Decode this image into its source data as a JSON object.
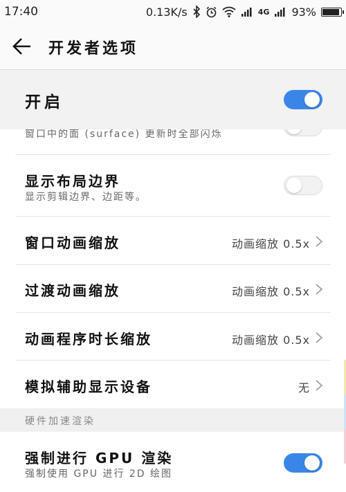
{
  "status_bar": {
    "time": "17:40",
    "speed": "0.13K/s",
    "network": "4G",
    "battery_percent": "93%",
    "battery_level": 0.93,
    "icons": [
      "bluetooth-icon",
      "alarm-icon",
      "wifi-icon",
      "signal-icon",
      "signal-icon",
      "battery-icon"
    ]
  },
  "header": {
    "title": "开发者选项",
    "back_icon": "back-arrow-icon"
  },
  "master_toggle": {
    "label": "开启",
    "on": true
  },
  "partial_row": {
    "text": "窗口中的面 (surface) 更新时全部闪烁",
    "on": false
  },
  "rows": [
    {
      "title": "显示布局边界",
      "subtitle": "显示剪辑边界、边距等。",
      "toggle": false
    },
    {
      "title": "窗口动画缩放",
      "value": "动画缩放 0.5x"
    },
    {
      "title": "过渡动画缩放",
      "value": "动画缩放 0.5x"
    },
    {
      "title": "动画程序时长缩放",
      "value": "动画缩放 0.5x"
    },
    {
      "title": "模拟辅助显示设备",
      "value": "无"
    }
  ],
  "section": {
    "label": "硬件加速渲染"
  },
  "gpu_row": {
    "title": "强制进行 GPU 渲染",
    "subtitle": "强制使用 GPU 进行 2D 绘图",
    "toggle": true
  },
  "colors": {
    "accent": "#3a86e8",
    "background": "#ffffff",
    "header_background": "#fafafa"
  }
}
